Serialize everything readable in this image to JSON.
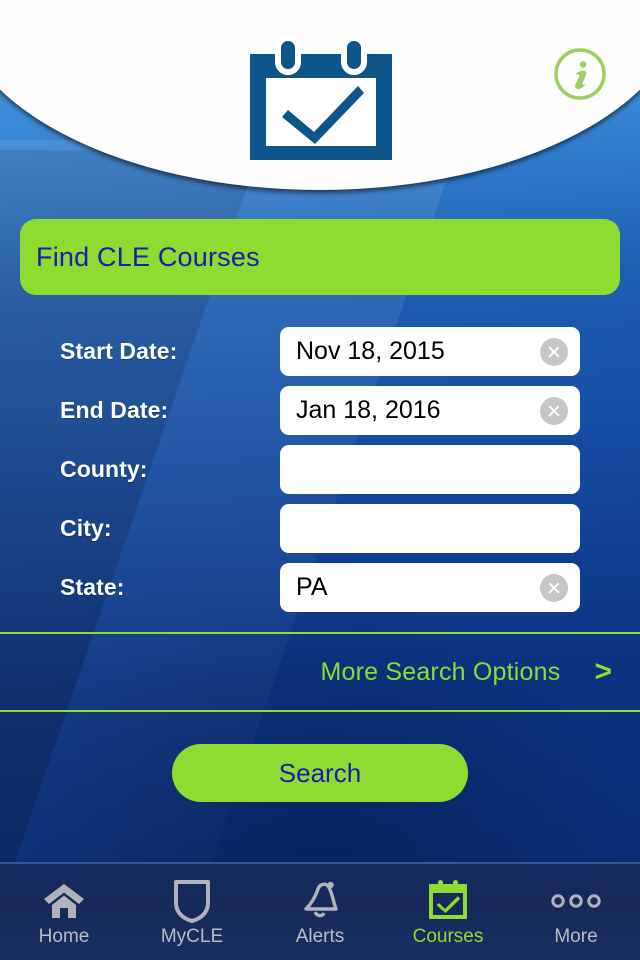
{
  "app": {
    "accent_green": "#8edc31",
    "brand_blue": "#0d5489",
    "title_text_color": "#1b1bad"
  },
  "header": {
    "logo_icon": "calendar-check-icon",
    "info_button": {
      "icon": "info-circle-icon",
      "label": "i"
    }
  },
  "title_bar": {
    "text": "Find CLE Courses"
  },
  "form": {
    "fields": [
      {
        "label": "Start Date:",
        "value": "Nov 18, 2015",
        "placeholder": "",
        "clearable": true
      },
      {
        "label": "End Date:",
        "value": "Jan 18, 2016",
        "placeholder": "",
        "clearable": true
      },
      {
        "label": "County:",
        "value": "",
        "placeholder": "",
        "clearable": false
      },
      {
        "label": "City:",
        "value": "",
        "placeholder": "",
        "clearable": false
      },
      {
        "label": "State:",
        "value": "PA",
        "placeholder": "",
        "clearable": true
      }
    ]
  },
  "more_options": {
    "label": "More Search Options",
    "chevron": ">"
  },
  "search_button": {
    "label": "Search"
  },
  "tabbar": {
    "items": [
      {
        "label": "Home",
        "icon": "home-icon",
        "active": false
      },
      {
        "label": "MyCLE",
        "icon": "shield-icon",
        "active": false
      },
      {
        "label": "Alerts",
        "icon": "bell-icon",
        "active": false
      },
      {
        "label": "Courses",
        "icon": "calendar-check-icon",
        "active": true
      },
      {
        "label": "More",
        "icon": "three-dots-icon",
        "active": false
      }
    ]
  }
}
